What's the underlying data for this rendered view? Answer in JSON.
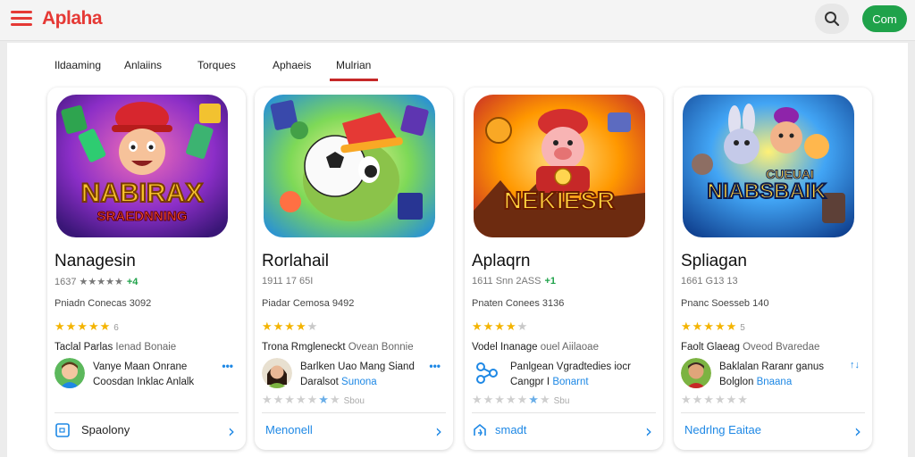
{
  "header": {
    "logo": "Aplaha",
    "cta_label": "Com"
  },
  "tabs": [
    "Ildaaming",
    "Anlaiins",
    "Torques",
    "Aphaeis",
    "Mulrian"
  ],
  "cards": [
    {
      "art_text_1": "NABIRAX",
      "art_text_2": "SRAEDNNING",
      "title": "Nanagesin",
      "stats": "1637 ★★★★★",
      "stats_badge": "+4",
      "meta": "Pniadn Conecas 3092",
      "rating": 5,
      "rating_count": "6",
      "desc_a": "Taclal Parlas",
      "desc_b": "Ienad Bonaie",
      "dev_line1": "Vanye Maan Onrane",
      "dev_line2a": "Coosdan Inklac Anlalk",
      "dev_line2b": "",
      "action_label": "Spaolony"
    },
    {
      "art_text_1": "",
      "art_text_2": "",
      "title": "Rorlahail",
      "stats": "1911 17 65I",
      "stats_badge": "",
      "meta": "Piadar Cemosa 9492",
      "rating": 4,
      "rating_count": "",
      "desc_a": "Trona Rmgleneckt",
      "desc_b": "Ovean Bonnie",
      "dev_line1": "Barlken Uao Mang Siand",
      "dev_line2a": "Daralsot",
      "dev_line2b": "Sunona",
      "mini_count": "Sbou",
      "action_label": "Menonell"
    },
    {
      "art_text_1": "NEKIESR",
      "art_text_2": "",
      "title": "Aplaqrn",
      "stats": "1611 Snn 2ASS",
      "stats_badge": "+1",
      "meta": "Pnaten Conees 3136",
      "rating": 4,
      "rating_count": "",
      "desc_a": "Vodel Inanage",
      "desc_b": "ouel Aiilaoae",
      "dev_line1": "Panlgean Vgradtedies iocr",
      "dev_line2a": "Cangpr I",
      "dev_line2b": "Bonarnt",
      "mini_count": "Sbu",
      "action_label": "smadt"
    },
    {
      "art_text_1": "NIABSBAIK",
      "art_text_2": "CUEUAI",
      "title": "Spliagan",
      "stats": "1661 G13 13",
      "stats_badge": "",
      "meta": "Pnanc Soesseb 140",
      "rating": 5,
      "rating_count": "5",
      "desc_a": "Faolt Glaeag",
      "desc_b": "Oveod Bvaredae",
      "dev_line1": "Baklalan Raranr ganus",
      "dev_line2a": "Bolglon",
      "dev_line2b": "Bnaana",
      "mini_count": "",
      "action_label": "Nedrlng Eaitae"
    }
  ],
  "colors": {
    "accent": "#e53935",
    "cta": "#1fa24a",
    "link": "#1e88e5",
    "star": "#f4b400"
  },
  "icons": [
    "menu-icon",
    "search-icon",
    "more-horizontal-icon",
    "chevron-right-icon",
    "calendar-icon",
    "share-icon"
  ]
}
